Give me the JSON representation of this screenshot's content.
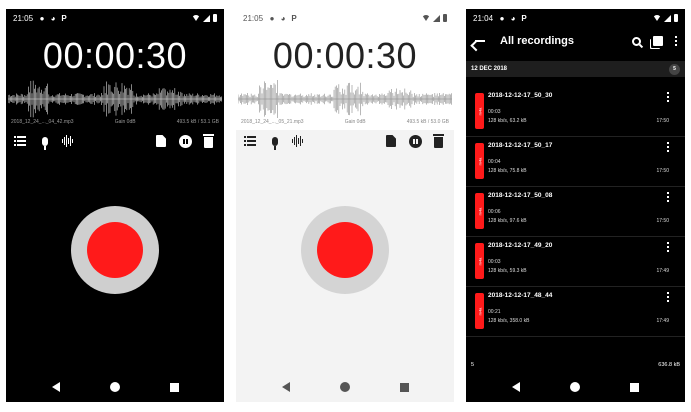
{
  "screens": [
    {
      "status_time": "21:05",
      "status_icons": [
        "circle-icon",
        "circle-icon",
        "p-icon"
      ],
      "timer": "00:00:30",
      "meta_file": "2018_12_24_..._04_42.mp3",
      "meta_mid": "Gain 0dB",
      "meta_size": "493.5 kB / 53.1 GB",
      "toolbar": [
        "list-icon",
        "mic-icon",
        "waveform-icon",
        "add-file-icon",
        "pause-icon",
        "trash-icon"
      ]
    },
    {
      "status_time": "21:05",
      "status_icons": [
        "circle-icon",
        "circle-icon",
        "p-icon"
      ],
      "timer": "00:00:30",
      "meta_file": "2018_12_24_..._05_21.mp3",
      "meta_mid": "Gain 0dB",
      "meta_size": "493.5 kB / 53.0 GB",
      "toolbar": [
        "list-icon",
        "mic-icon",
        "waveform-icon",
        "add-file-icon",
        "pause-icon",
        "trash-icon"
      ]
    }
  ],
  "list_screen": {
    "status_time": "21:04",
    "title": "All recordings",
    "section_label": "12 DEC 2018",
    "section_count": "5",
    "items": [
      {
        "name": "2018-12-12-17_50_30",
        "duration": "00:03",
        "info": "128 kb/s, 63.2 kB",
        "time": "17:50",
        "badge": "m4a"
      },
      {
        "name": "2018-12-12-17_50_17",
        "duration": "00:04",
        "info": "128 kb/s, 75.8 kB",
        "time": "17:50",
        "badge": "m4a"
      },
      {
        "name": "2018-12-12-17_50_08",
        "duration": "00:06",
        "info": "128 kb/s, 97.6 kB",
        "time": "17:50",
        "badge": "m4a"
      },
      {
        "name": "2018-12-12-17_49_20",
        "duration": "00:03",
        "info": "128 kb/s, 59.3 kB",
        "time": "17:49",
        "badge": "m4a"
      },
      {
        "name": "2018-12-12-17_48_44",
        "duration": "00:21",
        "info": "128 kb/s, 358.0 kB",
        "time": "17:49",
        "badge": "m4a"
      }
    ],
    "footer_count": "5",
    "footer_total": "636.8 kB"
  },
  "colors": {
    "record_red": "#ff1a1a",
    "dark_bg": "#000000",
    "light_bg": "#f3f3f3"
  }
}
